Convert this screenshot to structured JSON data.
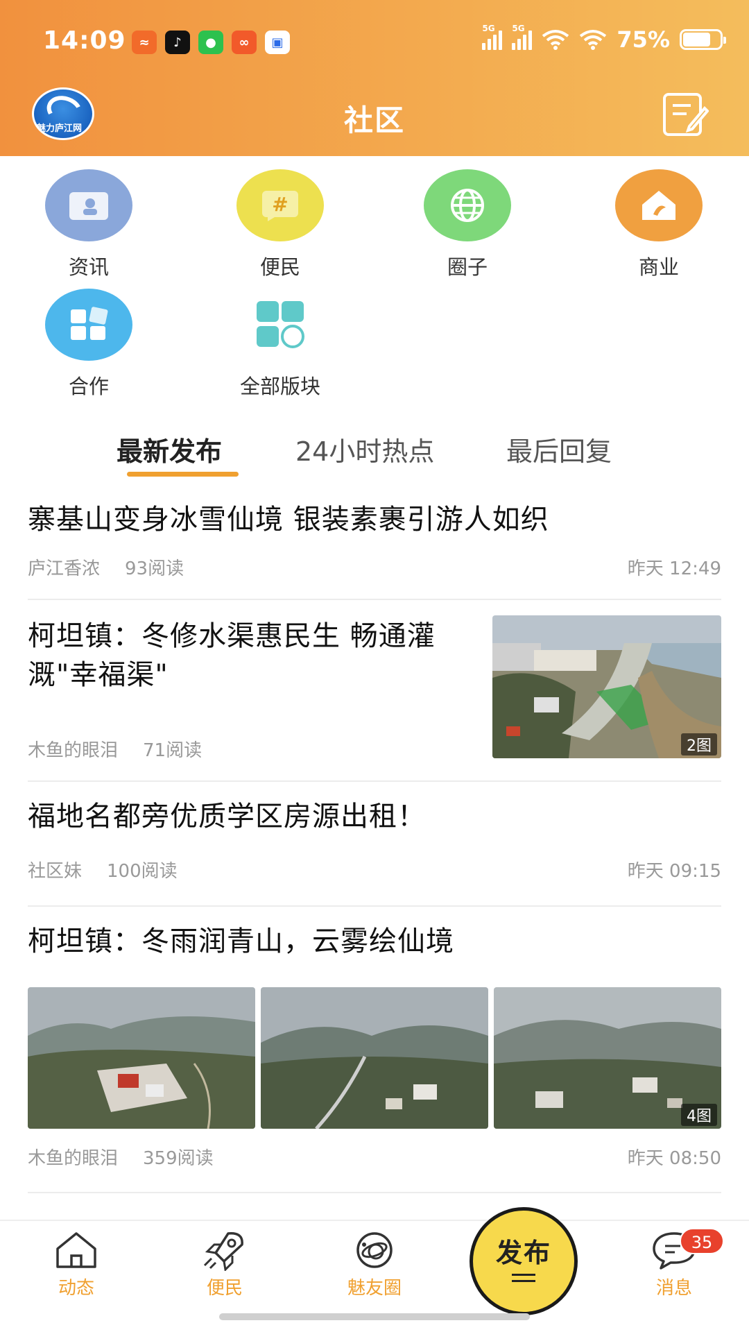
{
  "status_bar": {
    "time": "14:09",
    "network_1": "5G",
    "network_2": "5G",
    "battery": "75%"
  },
  "header": {
    "logo_text": "魅力庐江网",
    "title": "社区"
  },
  "categories": [
    {
      "label": "资讯",
      "icon": "news-icon",
      "color": "#8aa7da"
    },
    {
      "label": "便民",
      "icon": "hashtag-icon",
      "color": "#ede04f"
    },
    {
      "label": "圈子",
      "icon": "globe-icon",
      "color": "#7ed87a"
    },
    {
      "label": "商业",
      "icon": "shop-icon",
      "color": "#f0a040"
    },
    {
      "label": "合作",
      "icon": "cooperation-icon",
      "color": "#4db7ec"
    },
    {
      "label": "全部版块",
      "icon": "all-sections-icon",
      "color": "#5fc9c9"
    }
  ],
  "tabs": [
    {
      "label": "最新发布",
      "active": true
    },
    {
      "label": "24小时热点",
      "active": false
    },
    {
      "label": "最后回复",
      "active": false
    }
  ],
  "posts": [
    {
      "title": "寨基山变身冰雪仙境 银装素裹引游人如织",
      "author": "庐江香浓",
      "reads": "93阅读",
      "time": "昨天 12:49"
    },
    {
      "title": "柯坦镇：冬修水渠惠民生 畅通灌溉\"幸福渠\"",
      "author": "木鱼的眼泪",
      "reads": "71阅读",
      "image_count": "2图"
    },
    {
      "title": "福地名都旁优质学区房源出租！",
      "author": "社区妹",
      "reads": "100阅读",
      "time": "昨天 09:15"
    },
    {
      "title": "柯坦镇：冬雨润青山，云雾绘仙境",
      "author": "木鱼的眼泪",
      "reads": "359阅读",
      "time": "昨天 08:50",
      "image_count": "4图"
    }
  ],
  "bottom_nav": {
    "items": [
      {
        "label": "动态",
        "icon": "home-icon"
      },
      {
        "label": "便民",
        "icon": "rocket-icon"
      },
      {
        "label": "魅友圈",
        "icon": "planet-icon"
      },
      {
        "label": "消息",
        "icon": "message-icon",
        "badge": "35"
      }
    ],
    "publish_label": "发布"
  },
  "colors": {
    "header_start": "#f1913e",
    "header_end": "#f4bd5c",
    "accent": "#f0a030",
    "badge": "#e8412c"
  }
}
